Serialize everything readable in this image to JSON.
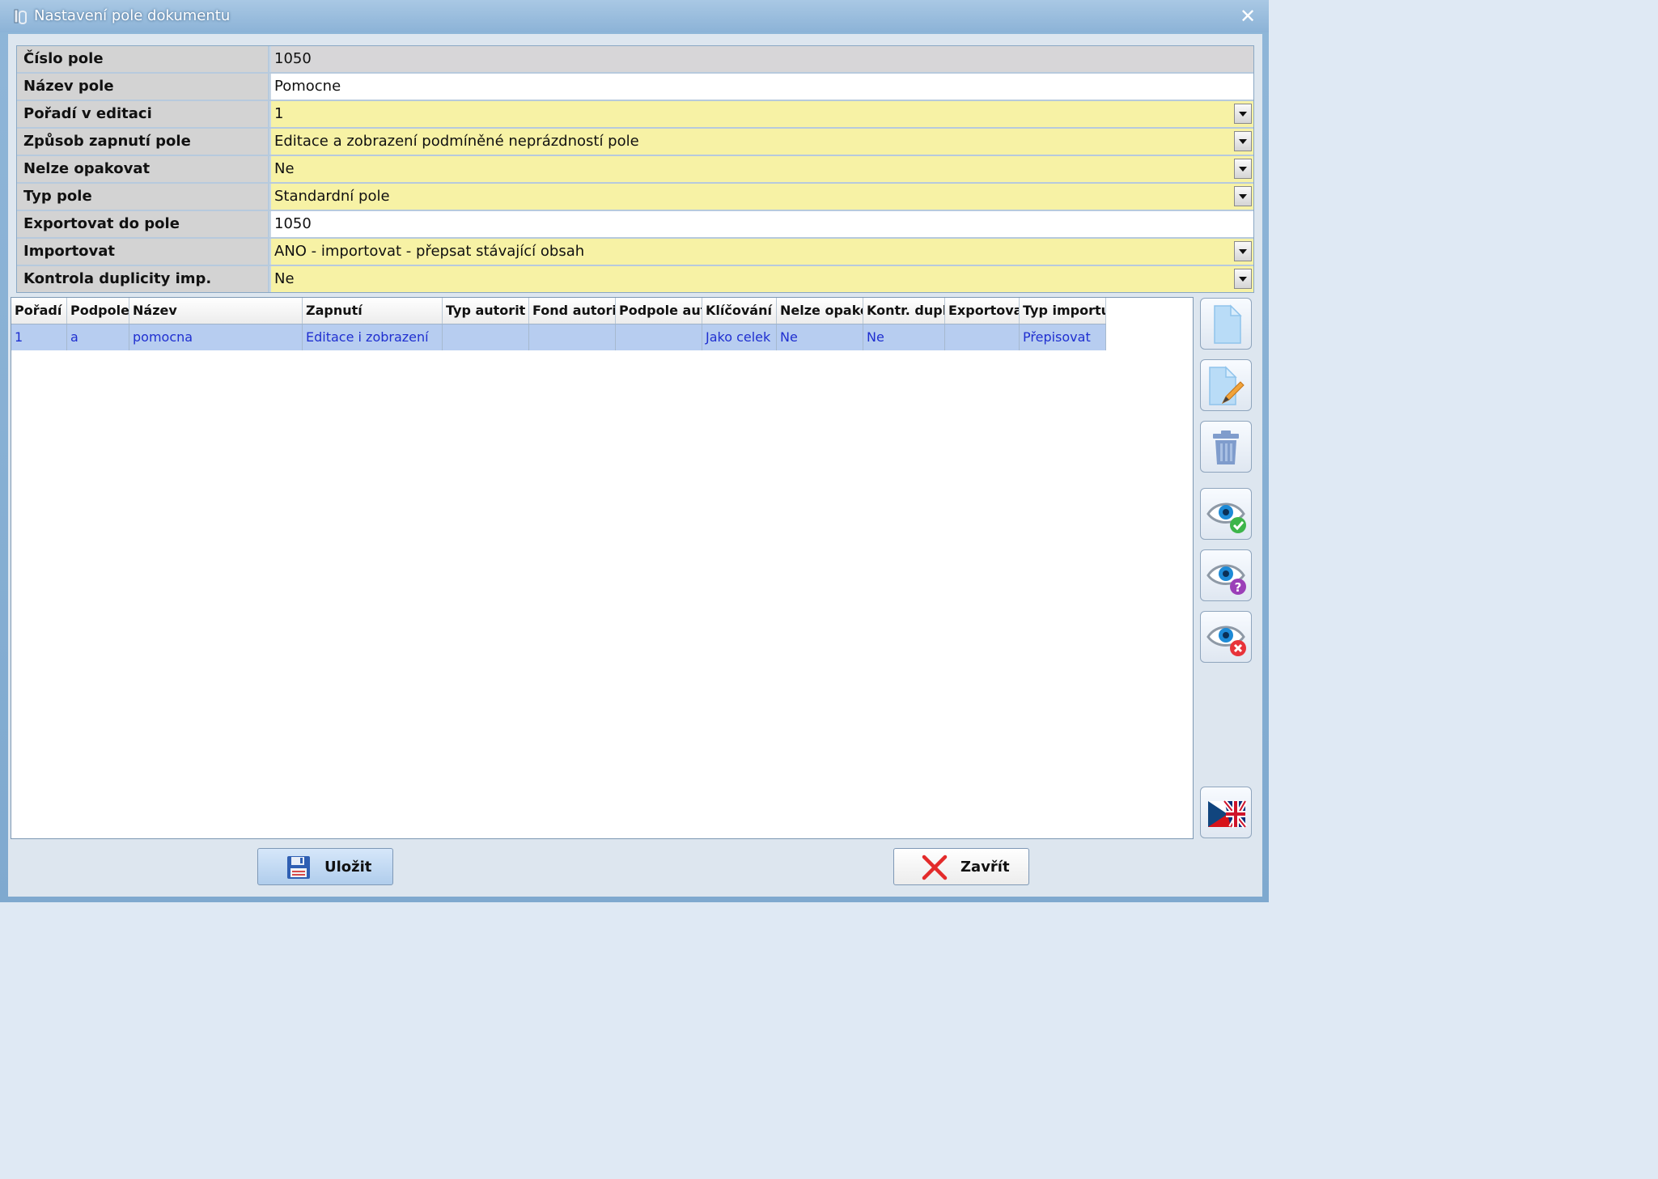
{
  "window": {
    "title": "Nastavení pole dokumentu",
    "close_label": "✕"
  },
  "properties": [
    {
      "label": "Číslo pole",
      "value": "1050",
      "style": "gray",
      "dropdown": false
    },
    {
      "label": "Název pole",
      "value": "Pomocne",
      "style": "white",
      "dropdown": false
    },
    {
      "label": "Pořadí v editaci",
      "value": "1",
      "style": "yellow",
      "dropdown": true
    },
    {
      "label": "Způsob zapnutí pole",
      "value": "Editace a zobrazení podmíněné neprázdností pole",
      "style": "yellow",
      "dropdown": true
    },
    {
      "label": "Nelze opakovat",
      "value": "Ne",
      "style": "yellow",
      "dropdown": true
    },
    {
      "label": "Typ pole",
      "value": "Standardní pole",
      "style": "yellow",
      "dropdown": true
    },
    {
      "label": "Exportovat do pole",
      "value": "1050",
      "style": "white",
      "dropdown": false
    },
    {
      "label": "Importovat",
      "value": "ANO - importovat - přepsat stávající obsah",
      "style": "yellow",
      "dropdown": true
    },
    {
      "label": "Kontrola duplicity imp.",
      "value": "Ne",
      "style": "yellow",
      "dropdown": true
    }
  ],
  "grid": {
    "columns": [
      "Pořadí",
      "Podpole",
      "Název",
      "Zapnutí",
      "Typ autorit",
      "Fond autori",
      "Podpole aut",
      "Klíčování",
      "Nelze opako",
      "Kontr. dupl",
      "Exportova",
      "Typ importu"
    ],
    "rows": [
      [
        "1",
        "a",
        "pomocna",
        "Editace i zobrazení",
        "",
        "",
        "",
        "Jako celek",
        "Ne",
        "Ne",
        "",
        "Přepisovat"
      ]
    ]
  },
  "side_buttons": [
    "new-document-icon",
    "edit-document-icon",
    "trash-icon",
    "eye-check-icon",
    "eye-question-icon",
    "eye-cross-icon",
    "language-flag-icon"
  ],
  "buttons": {
    "save_label": "Uložit",
    "close_label": "Zavřít"
  },
  "colors": {
    "yellow_field": "#f7f2a5",
    "selected_row": "#b7cdf0",
    "grid_text": "#1f2fd0"
  }
}
